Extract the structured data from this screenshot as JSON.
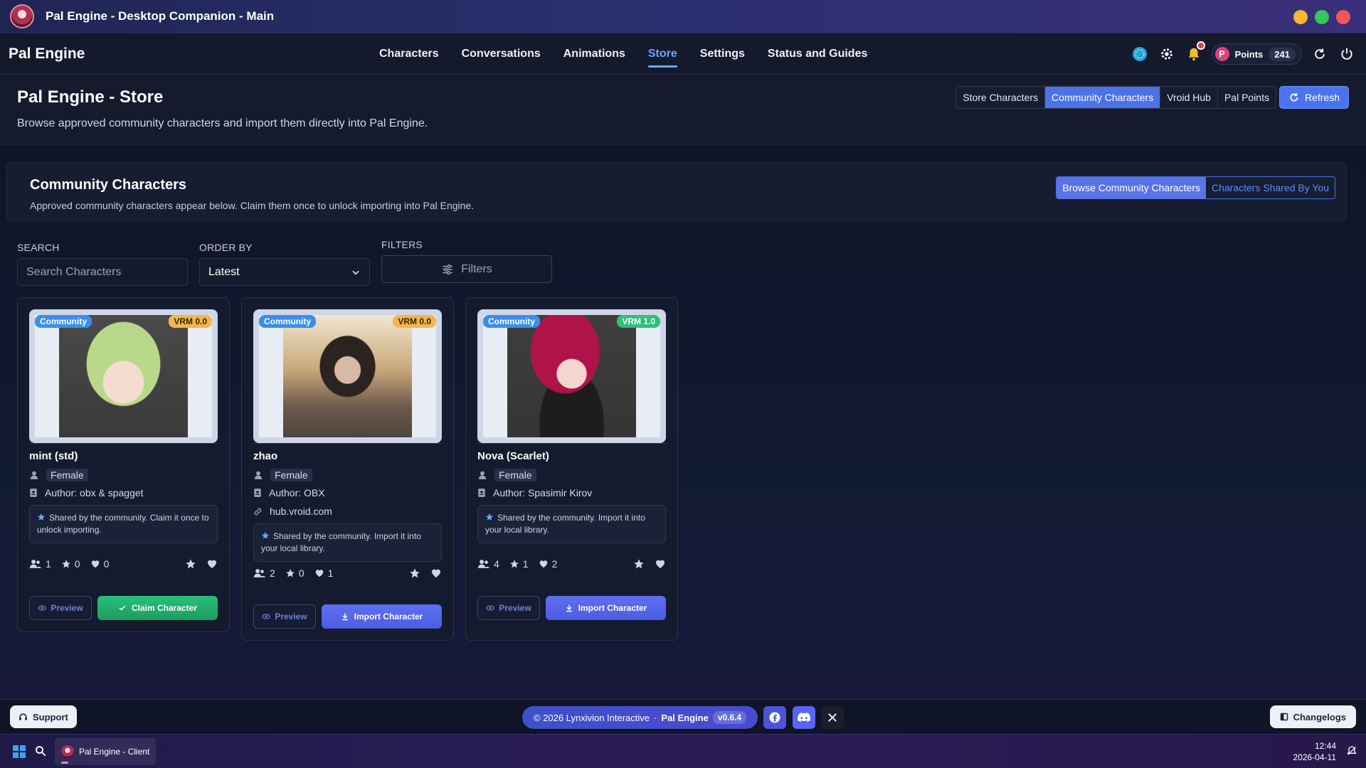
{
  "window": {
    "title": "Pal Engine - Desktop Companion - Main"
  },
  "nav": {
    "brand": "Pal Engine",
    "items": [
      "Characters",
      "Conversations",
      "Animations",
      "Store",
      "Settings",
      "Status and Guides"
    ],
    "active": "Store",
    "points_label": "Points",
    "points_value": "241"
  },
  "header": {
    "title": "Pal Engine - Store",
    "subtitle": "Browse approved community characters and import them directly into Pal Engine.",
    "tabs": [
      "Store Characters",
      "Community Characters",
      "Vroid Hub",
      "Pal Points"
    ],
    "active_tab": "Community Characters",
    "refresh_label": "Refresh"
  },
  "section": {
    "title": "Community Characters",
    "subtitle": "Approved community characters appear below. Claim them once to unlock importing into Pal Engine.",
    "toggle": [
      "Browse Community Characters",
      "Characters Shared By You"
    ]
  },
  "filters": {
    "search_label": "SEARCH",
    "search_placeholder": "Search Characters",
    "order_label": "ORDER BY",
    "order_value": "Latest",
    "filters_label": "FILTERS",
    "filters_button": "Filters"
  },
  "cards": [
    {
      "name": "mint (std)",
      "badge": "Community",
      "vrm": "VRM 0.0",
      "gender": "Female",
      "author": "Author: obx & spagget",
      "source": "",
      "note": "Shared by the community. Claim it once to unlock importing.",
      "users": "1",
      "stars": "0",
      "likes": "0",
      "preview_label": "Preview",
      "action_label": "Claim Character",
      "action_type": "claim"
    },
    {
      "name": "zhao",
      "badge": "Community",
      "vrm": "VRM 0.0",
      "gender": "Female",
      "author": "Author: OBX",
      "source": "hub.vroid.com",
      "note": "Shared by the community. Import it into your local library.",
      "users": "2",
      "stars": "0",
      "likes": "1",
      "preview_label": "Preview",
      "action_label": "Import Character",
      "action_type": "import"
    },
    {
      "name": "Nova (Scarlet)",
      "badge": "Community",
      "vrm": "VRM 1.0",
      "gender": "Female",
      "author": "Author: Spasimir Kirov",
      "source": "",
      "note": "Shared by the community. Import it into your local library.",
      "users": "4",
      "stars": "1",
      "likes": "2",
      "preview_label": "Preview",
      "action_label": "Import Character",
      "action_type": "import"
    }
  ],
  "footer": {
    "support_label": "Support",
    "copyright": "© 2026 Lynxivion Interactive",
    "brand": "Pal Engine",
    "version": "v0.6.4",
    "changelogs_label": "Changelogs",
    "social_icons": [
      "facebook-icon",
      "discord-icon",
      "x-icon"
    ]
  },
  "taskbar": {
    "app_label": "Pal Engine - Client",
    "time": "12:44",
    "date": "2026-04-11"
  },
  "colors": {
    "accent": "#4c72e8",
    "claim_green": "#22ad6b",
    "import_blue": "#5566ea",
    "vrm0_badge": "#f2b650",
    "vrm1_badge": "#2fbf7a"
  }
}
